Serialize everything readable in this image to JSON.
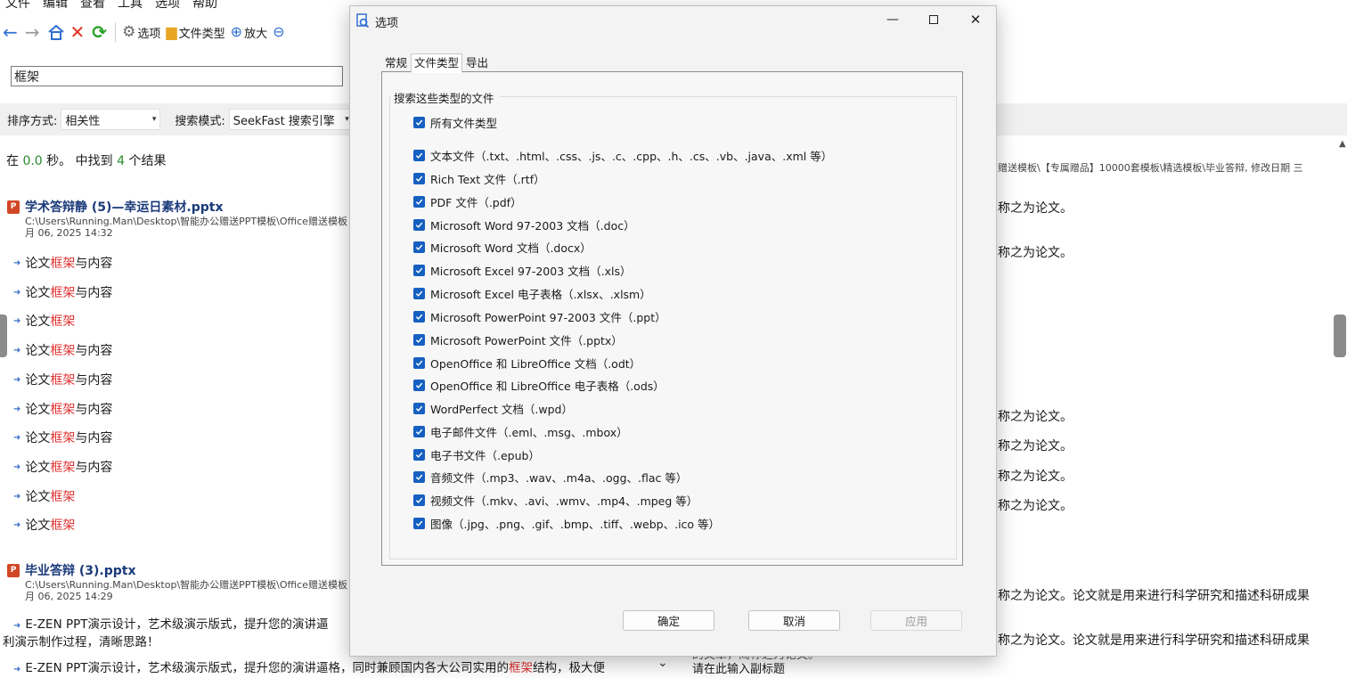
{
  "menu": [
    "文件",
    "编辑",
    "查看",
    "工具",
    "选项",
    "帮助"
  ],
  "toolbar": {
    "options_label": "选项",
    "filetypes_label": "文件类型",
    "zoom_in_label": "放大"
  },
  "search": {
    "value": "框架"
  },
  "sort": {
    "label": "排序方式:",
    "value": "相关性",
    "mode_label": "搜索模式:",
    "mode_value": "SeekFast 搜索引擎"
  },
  "summary": {
    "prefix": "在",
    "seconds": "0.0",
    "mid": "秒。 中找到",
    "count": "4",
    "suffix": "个结果"
  },
  "results": [
    {
      "title": "学术答辩静 (5)—幸运日素材.pptx",
      "path_line1": "C:\\Users\\Running.Man\\Desktop\\智能办公赠送PPT模板\\Office赠送模板",
      "path_line2": "月 06, 2025 14:32"
    },
    {
      "title": "毕业答辩 (3).pptx",
      "path_line1": "C:\\Users\\Running.Man\\Desktop\\智能办公赠送PPT模板\\Office赠送模板",
      "path_line2": "月 06, 2025 14:29"
    }
  ],
  "hits": [
    {
      "pre": "论文",
      "hl": "框架",
      "post": "与内容"
    },
    {
      "pre": "论文",
      "hl": "框架",
      "post": "与内容"
    },
    {
      "pre": "论文",
      "hl": "框架",
      "post": ""
    },
    {
      "pre": "论文",
      "hl": "框架",
      "post": "与内容"
    },
    {
      "pre": "论文",
      "hl": "框架",
      "post": "与内容"
    },
    {
      "pre": "论文",
      "hl": "框架",
      "post": "与内容"
    },
    {
      "pre": "论文",
      "hl": "框架",
      "post": "与内容"
    },
    {
      "pre": "论文",
      "hl": "框架",
      "post": "与内容"
    },
    {
      "pre": "论文",
      "hl": "框架",
      "post": ""
    },
    {
      "pre": "论文",
      "hl": "框架",
      "post": ""
    }
  ],
  "long_hit_1": {
    "line1": "E-ZEN PPT演示设计，艺术级演示版式，提升您的演讲逼",
    "line2": "利演示制作过程，清晰思路！"
  },
  "long_hit_2": {
    "pre": "E-ZEN PPT演示设计，艺术级演示版式，提升您的演讲逼格，同时兼顾国内各大公司实用的",
    "hl": "框架",
    "post": "结构，极大便"
  },
  "right_panel": {
    "path": "赠送模板\\【专属赠品】10000套模板\\精选模板\\毕业答辩, 修改日期 三",
    "lines": [
      "称之为论文。",
      "称之为论文。",
      "称之为论文。",
      "称之为论文。",
      "称之为论文。",
      "称之为论文。",
      "称之为论文。论文就是用来进行科学研究和描述科研成果",
      "称之为论文。论文就是用来进行科学研究和描述科研成果"
    ],
    "partial_line": "的文章，简称之为论文。",
    "subtitle_prompt": "请在此输入副标题"
  },
  "dialog": {
    "title": "选项",
    "tabs": [
      "常规",
      "文件类型",
      "导出"
    ],
    "active_tab": "文件类型",
    "group_title": "搜索这些类型的文件",
    "all_types": "所有文件类型",
    "types": [
      "文本文件（.txt、.html、.css、.js、.c、.cpp、.h、.cs、.vb、.java、.xml 等）",
      "Rich Text 文件（.rtf）",
      "PDF 文件（.pdf）",
      "Microsoft Word 97-2003 文档（.doc）",
      "Microsoft Word 文档（.docx）",
      "Microsoft Excel 97-2003 文档（.xls）",
      "Microsoft Excel 电子表格（.xlsx、.xlsm）",
      "Microsoft PowerPoint 97-2003 文件（.ppt）",
      "Microsoft PowerPoint 文件（.pptx）",
      "OpenOffice 和 LibreOffice 文档（.odt）",
      "OpenOffice 和 LibreOffice 电子表格（.ods）",
      "WordPerfect 文档（.wpd）",
      "电子邮件文件（.eml、.msg、.mbox）",
      "电子书文件（.epub）",
      "音频文件（.mp3、.wav、.m4a、.ogg、.flac 等）",
      "视频文件（.mkv、.avi、.wmv、.mp4、.mpeg 等）",
      "图像（.jpg、.png、.gif、.bmp、.tiff、.webp、.ico 等）"
    ],
    "ok_label": "确定",
    "cancel_label": "取消",
    "apply_label": "应用"
  },
  "colors": {
    "accent": "#1560c0",
    "highlight": "#e03030",
    "count_green": "#2a8a2a"
  }
}
